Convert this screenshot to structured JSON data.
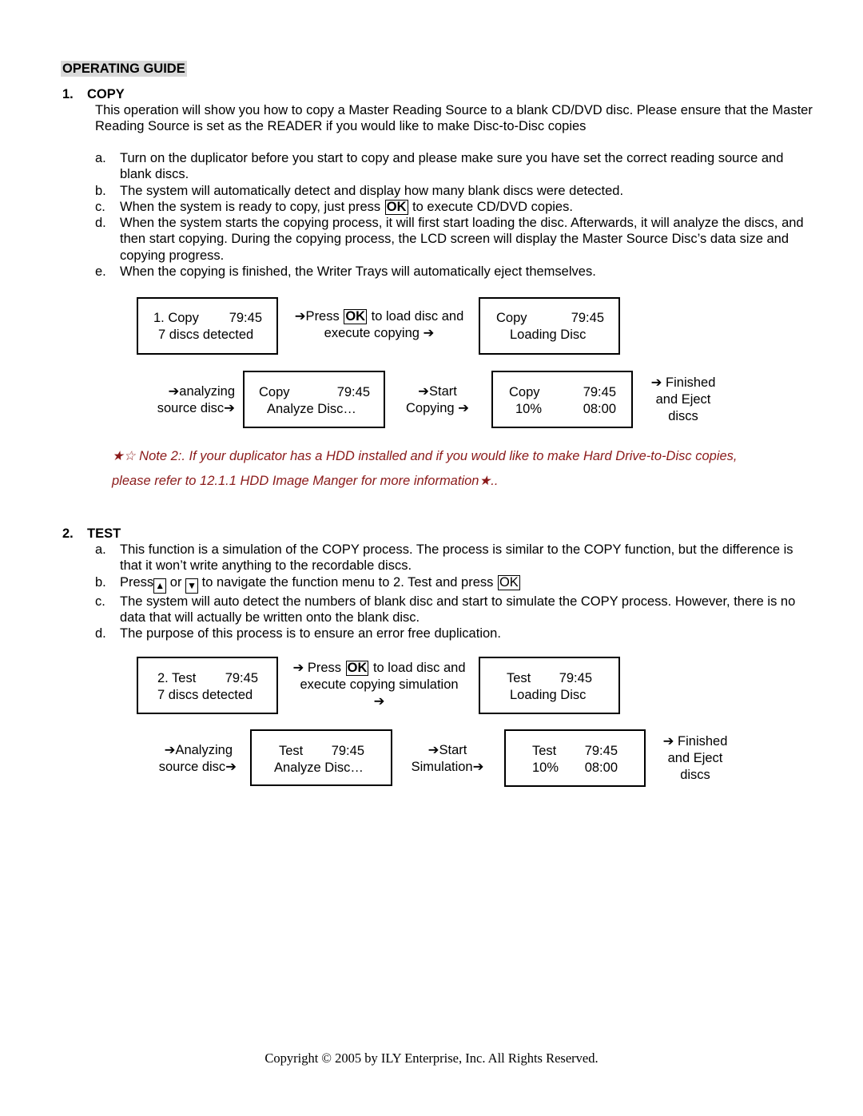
{
  "guide_title": "OPERATING GUIDE",
  "sections": [
    {
      "number": "1.",
      "title": "COPY",
      "intro": "This operation will show you how to copy a Master Reading Source to a blank CD/DVD disc. Please ensure that the Master Reading Source is set as the READER if you would like to make Disc-to-Disc copies",
      "steps": [
        {
          "marker": "a.",
          "text": "Turn on the duplicator before you start to copy and please make sure you have set the correct reading source and blank discs."
        },
        {
          "marker": "b.",
          "text": "The system will automatically detect and display how many blank discs were detected."
        },
        {
          "marker": "c.",
          "pre": "When the system is ready to copy, just press ",
          "key": "OK",
          "post": " to execute CD/DVD copies."
        },
        {
          "marker": "d.",
          "text": "When the system starts the copying process, it will first start loading the disc.   Afterwards, it will analyze the discs, and then start copying.  During the copying process, the LCD screen will display the Master Source Disc’s data size and copying progress."
        },
        {
          "marker": "e.",
          "text": "When the copying is finished, the Writer Trays will automatically eject themselves."
        }
      ],
      "flow": {
        "lcd1": {
          "l1a": "1. Copy",
          "l1b": "79:45",
          "l2": "7 discs detected"
        },
        "cap1": {
          "pre": "➔Press ",
          "key": "OK",
          "post": " to load disc and",
          "l2": "execute copying ➔"
        },
        "lcd2": {
          "l1a": "Copy",
          "l1b": "79:45",
          "l2": "Loading Disc"
        },
        "cap2": {
          "l1": "➔analyzing",
          "l2": "source disc➔"
        },
        "lcd3": {
          "l1a": "Copy",
          "l1b": "79:45",
          "l2": "Analyze Disc…"
        },
        "cap3": {
          "l1": "➔Start",
          "l2": "Copying ➔"
        },
        "lcd4": {
          "l1a": "Copy",
          "l1b": "79:45",
          "l2a": "10%",
          "l2b": "08:00"
        },
        "cap4": {
          "l1": "➔ Finished",
          "l2": "and Eject",
          "l3": "discs"
        }
      }
    },
    {
      "number": "2.",
      "title": "TEST",
      "steps": [
        {
          "marker": "a.",
          "text": "This function is a simulation of the COPY process.  The process is similar to the COPY function, but the difference is that it won’t write anything to the recordable discs."
        },
        {
          "marker": "b.",
          "pre": "Press",
          "key_up": "▲",
          "mid1": " or ",
          "key_down": "▼",
          "mid2": " to navigate the function menu to 2. Test and press ",
          "key": "OK"
        },
        {
          "marker": "c.",
          "text": "The system will auto detect the numbers of blank disc and start to simulate the COPY process. However, there is no data that will actually be written onto the blank disc."
        },
        {
          "marker": "d.",
          "text": "The purpose of this process is to ensure an error free duplication."
        }
      ],
      "flow": {
        "lcd1": {
          "l1a": "2. Test",
          "l1b": "79:45",
          "l2": "7 discs detected"
        },
        "cap1": {
          "pre": "➔ Press ",
          "key": "OK",
          "post": " to load disc and",
          "l2": "execute copying simulation",
          "l3": "➔"
        },
        "lcd2": {
          "l1a": "Test",
          "l1b": "79:45",
          "l2": "Loading Disc"
        },
        "cap2": {
          "l1": "➔Analyzing",
          "l2": "source disc➔"
        },
        "lcd3": {
          "l1a": "Test",
          "l1b": "79:45",
          "l2": "Analyze Disc…"
        },
        "cap3": {
          "l1": "➔Start",
          "l2": "Simulation➔"
        },
        "lcd4": {
          "l1a": "Test",
          "l1b": "79:45",
          "l2a": "10%",
          "l2b": "08:00"
        },
        "cap4": {
          "l1": "➔ Finished",
          "l2": "and Eject",
          "l3": "discs"
        }
      }
    }
  ],
  "note": {
    "stars_open": "★☆",
    "line1": " Note 2:. If your duplicator has a HDD installed and if you would like to make Hard Drive-to-Disc copies,",
    "line2": "please refer to 12.1.1 HDD Image Manger for more information",
    "star_close": "★",
    "tail": ".."
  },
  "footer": "Copyright © 2005 by ILY Enterprise, Inc. All Rights Reserved."
}
